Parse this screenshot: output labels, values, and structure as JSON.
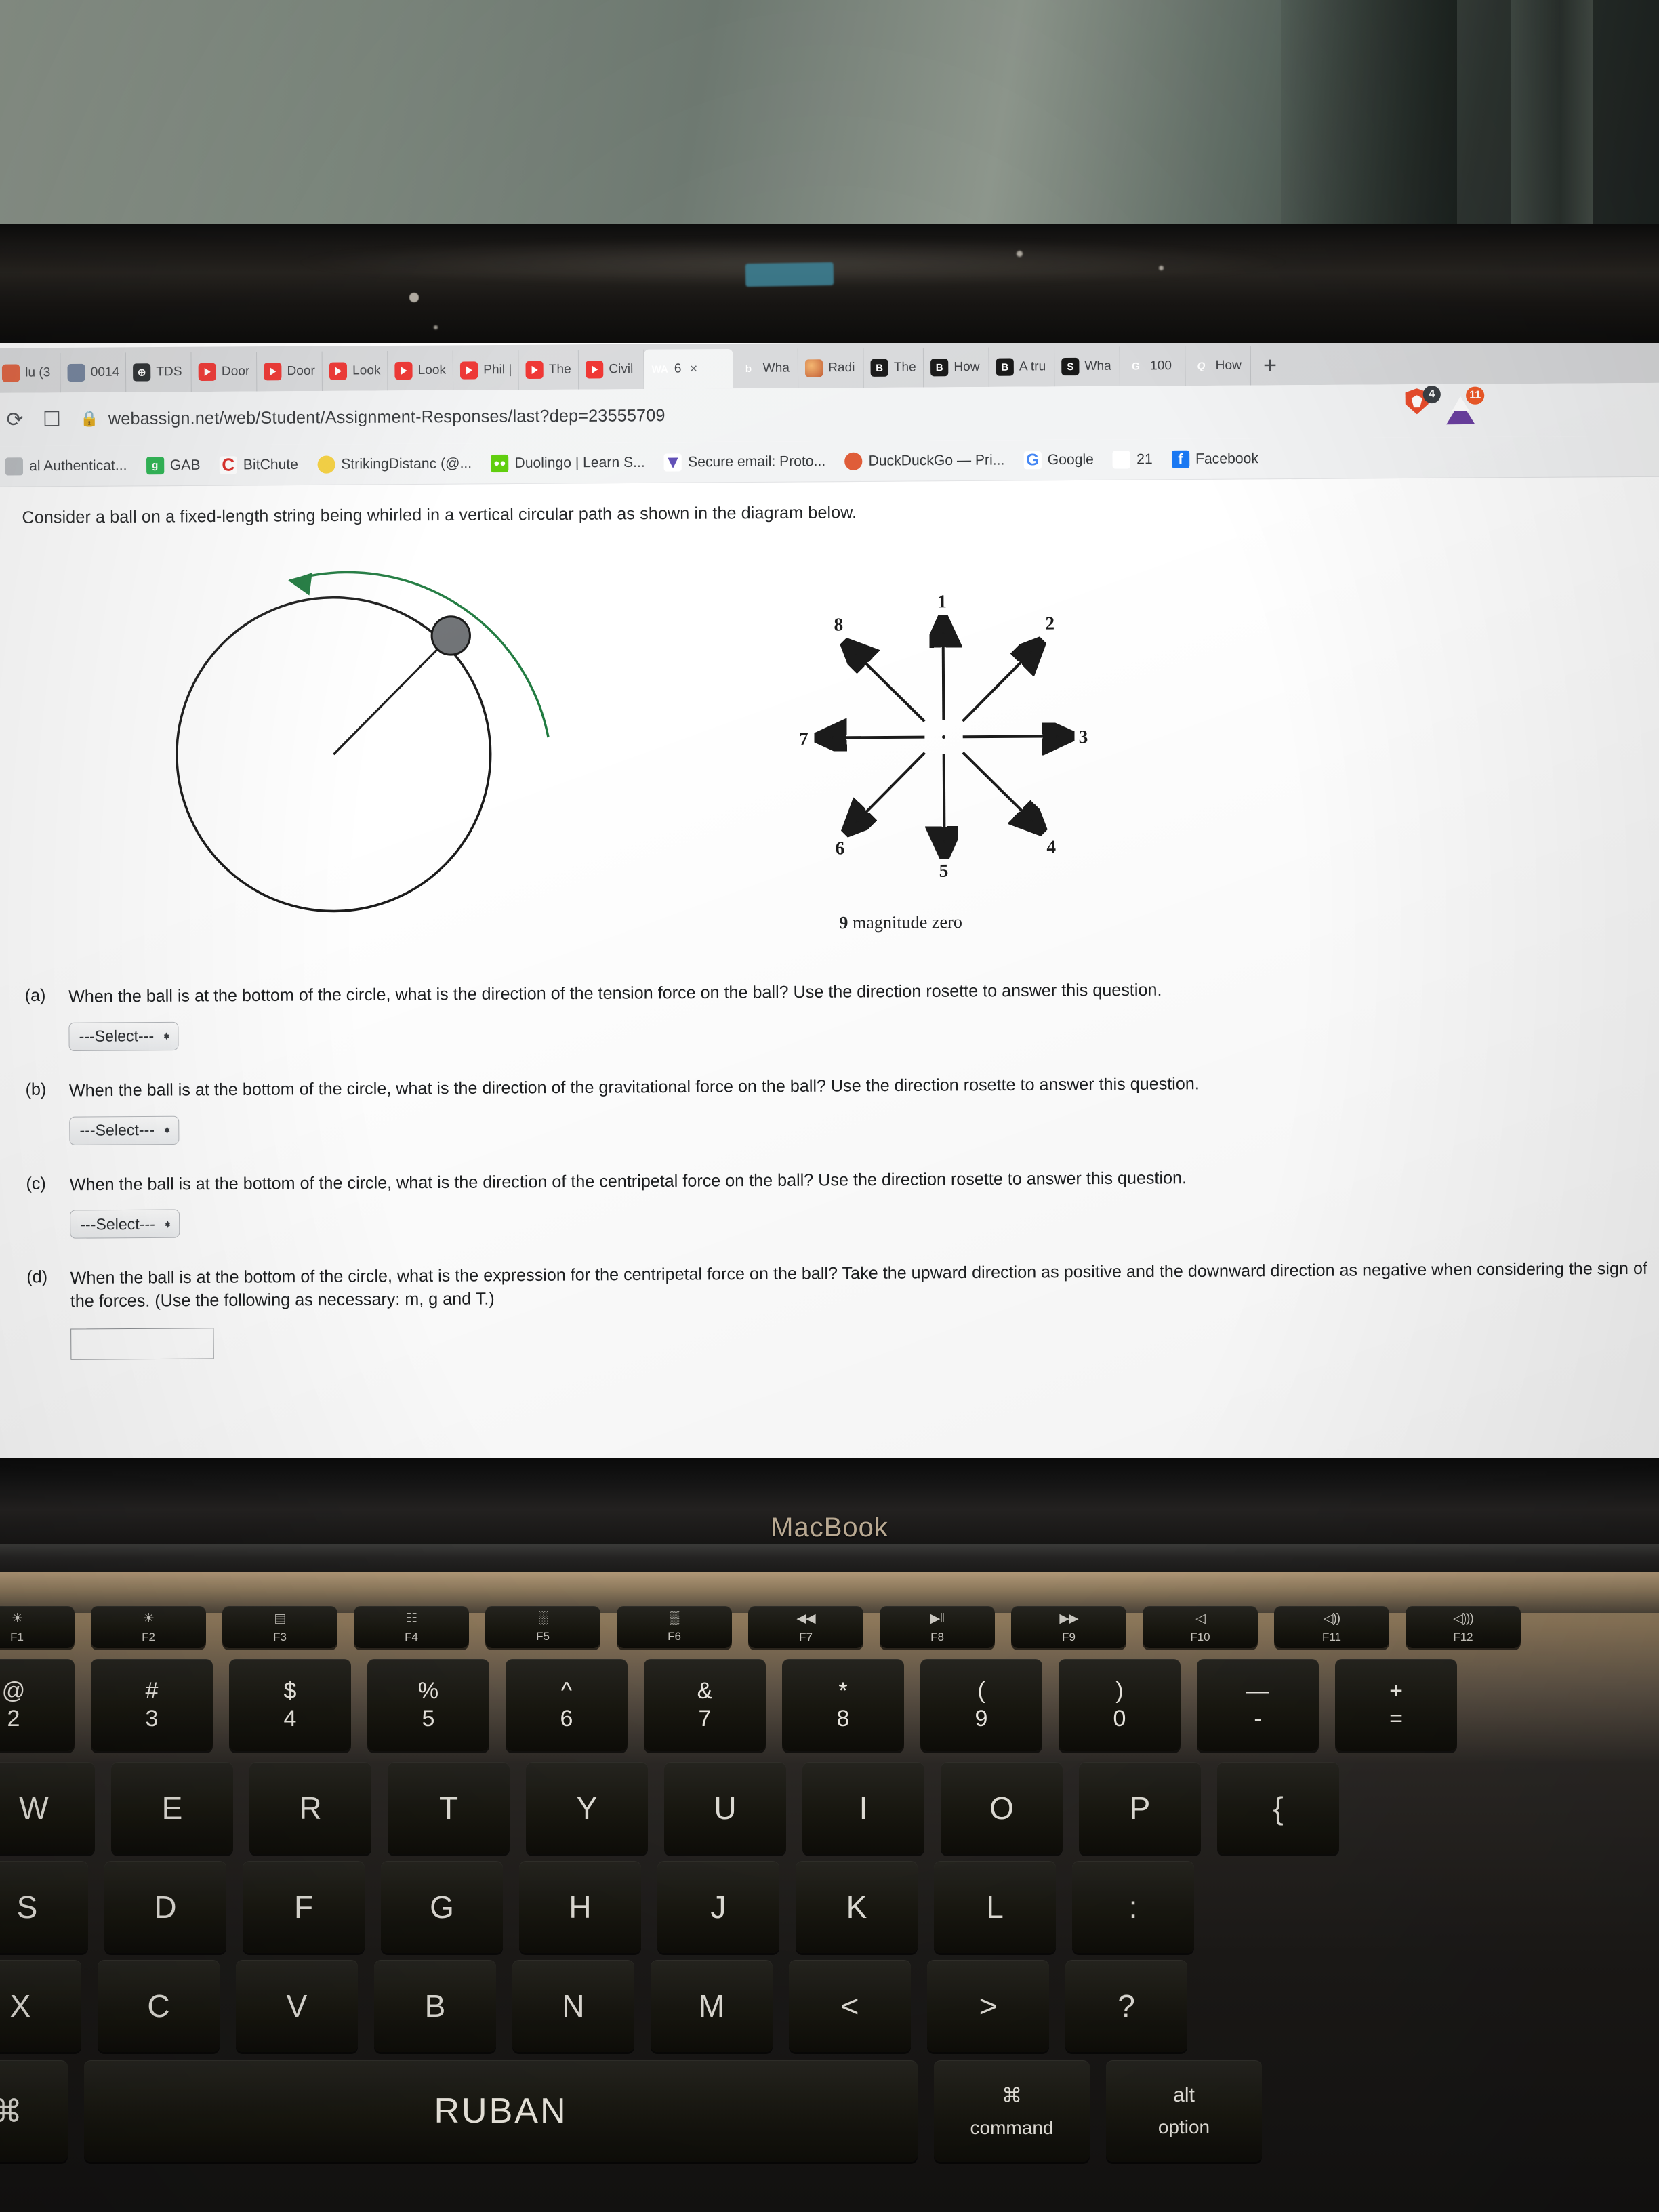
{
  "browser": {
    "tabs": [
      {
        "label": "lu (3",
        "icon": "duckduckgo-icon",
        "icon_class": "fav-dd",
        "glyph": "",
        "active": false
      },
      {
        "label": "0014",
        "icon": "mit-icon",
        "icon_class": "fav-mit",
        "glyph": "",
        "active": false
      },
      {
        "label": "TDS",
        "icon": "globe-icon",
        "icon_class": "fav-tds",
        "glyph": "⊕",
        "active": false
      },
      {
        "label": "Door",
        "icon": "youtube-icon",
        "icon_class": "fav-yt",
        "glyph": "",
        "active": false
      },
      {
        "label": "Door",
        "icon": "youtube-icon",
        "icon_class": "fav-yt",
        "glyph": "",
        "active": false
      },
      {
        "label": "Look",
        "icon": "youtube-icon",
        "icon_class": "fav-yt",
        "glyph": "",
        "active": false
      },
      {
        "label": "Look",
        "icon": "youtube-icon",
        "icon_class": "fav-yt",
        "glyph": "",
        "active": false
      },
      {
        "label": "Phil |",
        "icon": "youtube-icon",
        "icon_class": "fav-yt",
        "glyph": "",
        "active": false
      },
      {
        "label": "The",
        "icon": "youtube-icon",
        "icon_class": "fav-yt",
        "glyph": "",
        "active": false
      },
      {
        "label": "Civil",
        "icon": "youtube-icon",
        "icon_class": "fav-yt",
        "glyph": "",
        "active": false
      },
      {
        "label": "6",
        "icon": "webassign-icon",
        "icon_class": "fav-wa",
        "glyph": "WA",
        "active": true,
        "close": "×"
      },
      {
        "label": "Wha",
        "icon": "brainly-icon",
        "icon_class": "fav-b",
        "glyph": "b",
        "active": false
      },
      {
        "label": "Radi",
        "icon": "radio-icon",
        "icon_class": "fav-rad",
        "glyph": "",
        "active": false
      },
      {
        "label": "The",
        "icon": "bartleby-icon",
        "icon_class": "fav-blk",
        "glyph": "B",
        "active": false
      },
      {
        "label": "How",
        "icon": "bartleby-icon",
        "icon_class": "fav-blk",
        "glyph": "B",
        "active": false
      },
      {
        "label": "A tru",
        "icon": "bartleby-icon",
        "icon_class": "fav-blk",
        "glyph": "B",
        "active": false
      },
      {
        "label": "Wha",
        "icon": "slader-icon",
        "icon_class": "fav-s",
        "glyph": "S",
        "active": false
      },
      {
        "label": "100",
        "icon": "google-icon",
        "icon_class": "fav-g",
        "glyph": "G",
        "active": false
      },
      {
        "label": "How",
        "icon": "quizlet-icon",
        "icon_class": "fav-q",
        "glyph": "Q",
        "active": false
      }
    ],
    "new_tab_label": "+",
    "reload_icon": "⟳",
    "bookmark_icon": "☐",
    "lock_icon": "ὑ2",
    "url": "webassign.net/web/Student/Assignment-Responses/last?dep=23555709",
    "shield_badge": "4",
    "extension_badge": "11",
    "bookmarks": [
      {
        "label": "al Authenticat...",
        "icon_class": "ic-auth",
        "glyph": ""
      },
      {
        "label": "GAB",
        "icon_class": "ic-gab",
        "glyph": "g"
      },
      {
        "label": "BitChute",
        "icon_class": "ic-bit",
        "glyph": "C"
      },
      {
        "label": "StrikingDistanc (@...",
        "icon_class": "ic-sd",
        "glyph": ""
      },
      {
        "label": "Duolingo | Learn S...",
        "icon_class": "ic-duo",
        "glyph": "●●"
      },
      {
        "label": "Secure email: Proto...",
        "icon_class": "ic-pm",
        "glyph": "▼"
      },
      {
        "label": "DuckDuckGo — Pri...",
        "icon_class": "ic-ddg",
        "glyph": ""
      },
      {
        "label": "Google",
        "icon_class": "ic-goo",
        "glyph": "G"
      },
      {
        "label": "21",
        "icon_class": "ic-bit",
        "glyph": ""
      },
      {
        "label": "Facebook",
        "icon_class": "ic-fb",
        "glyph": "f"
      }
    ]
  },
  "page": {
    "intro": "Consider a ball on a fixed-length string being whirled in a vertical circular path as shown in the diagram below.",
    "figure_caption_number": "9",
    "figure_caption_text": " magnitude zero",
    "rosette_labels": [
      "1",
      "2",
      "3",
      "4",
      "5",
      "6",
      "7",
      "8"
    ],
    "parts": [
      {
        "label": "(a)",
        "text": "When the ball is at the bottom of the circle, what is the direction of the tension force on the ball? Use the direction rosette to answer this question.",
        "select_value": "---Select---"
      },
      {
        "label": "(b)",
        "text": "When the ball is at the bottom of the circle, what is the direction of the gravitational force on the ball? Use the direction rosette to answer this question.",
        "select_value": "---Select---"
      },
      {
        "label": "(c)",
        "text": "When the ball is at the bottom of the circle, what is the direction of the centripetal force on the ball? Use the direction rosette to answer this question.",
        "select_value": "---Select---"
      },
      {
        "label": "(d)",
        "text": "When the ball is at the bottom of the circle, what is the expression for the centripetal force on the ball? Take the upward direction as positive and the downward direction as negative when considering the sign of the forces. (Use the following as necessary: m, g and T.)",
        "select_value": ""
      }
    ]
  },
  "laptop": {
    "brand": "MacBook",
    "spacebar_text": "RUBAN",
    "command_label": "command",
    "command_symbol": "⌘",
    "option_label": "option",
    "alt_label": "alt",
    "function_keys": [
      {
        "name": "F1",
        "icon": "brightness-down-icon"
      },
      {
        "name": "F2",
        "icon": "brightness-up-icon"
      },
      {
        "name": "F3",
        "icon": "mission-control-icon"
      },
      {
        "name": "F4",
        "icon": "launchpad-icon"
      },
      {
        "name": "F5",
        "icon": "keyboard-dim-icon"
      },
      {
        "name": "F6",
        "icon": "keyboard-bright-icon"
      },
      {
        "name": "F7",
        "icon": "rewind-icon"
      },
      {
        "name": "F8",
        "icon": "play-pause-icon"
      },
      {
        "name": "F9",
        "icon": "fast-forward-icon"
      },
      {
        "name": "F10",
        "icon": "mute-icon"
      },
      {
        "name": "F11",
        "icon": "volume-down-icon"
      },
      {
        "name": "F12",
        "icon": "volume-up-icon"
      }
    ],
    "number_row": [
      {
        "top": "@",
        "bottom": "2"
      },
      {
        "top": "#",
        "bottom": "3"
      },
      {
        "top": "$",
        "bottom": "4"
      },
      {
        "top": "%",
        "bottom": "5"
      },
      {
        "top": "^",
        "bottom": "6"
      },
      {
        "top": "&",
        "bottom": "7"
      },
      {
        "top": "*",
        "bottom": "8"
      },
      {
        "top": "(",
        "bottom": "9"
      },
      {
        "top": ")",
        "bottom": "0"
      },
      {
        "top": "—",
        "bottom": "-"
      },
      {
        "top": "+",
        "bottom": "="
      }
    ],
    "row_q": [
      "W",
      "E",
      "R",
      "T",
      "Y",
      "U",
      "I",
      "O",
      "P",
      "{"
    ],
    "row_a": [
      "S",
      "D",
      "F",
      "G",
      "H",
      "J",
      "K",
      "L",
      ":"
    ],
    "row_z": [
      "X",
      "C",
      "V",
      "B",
      "N",
      "M",
      "<",
      ">",
      "?"
    ],
    "fn_row_left_label": "⌘"
  }
}
